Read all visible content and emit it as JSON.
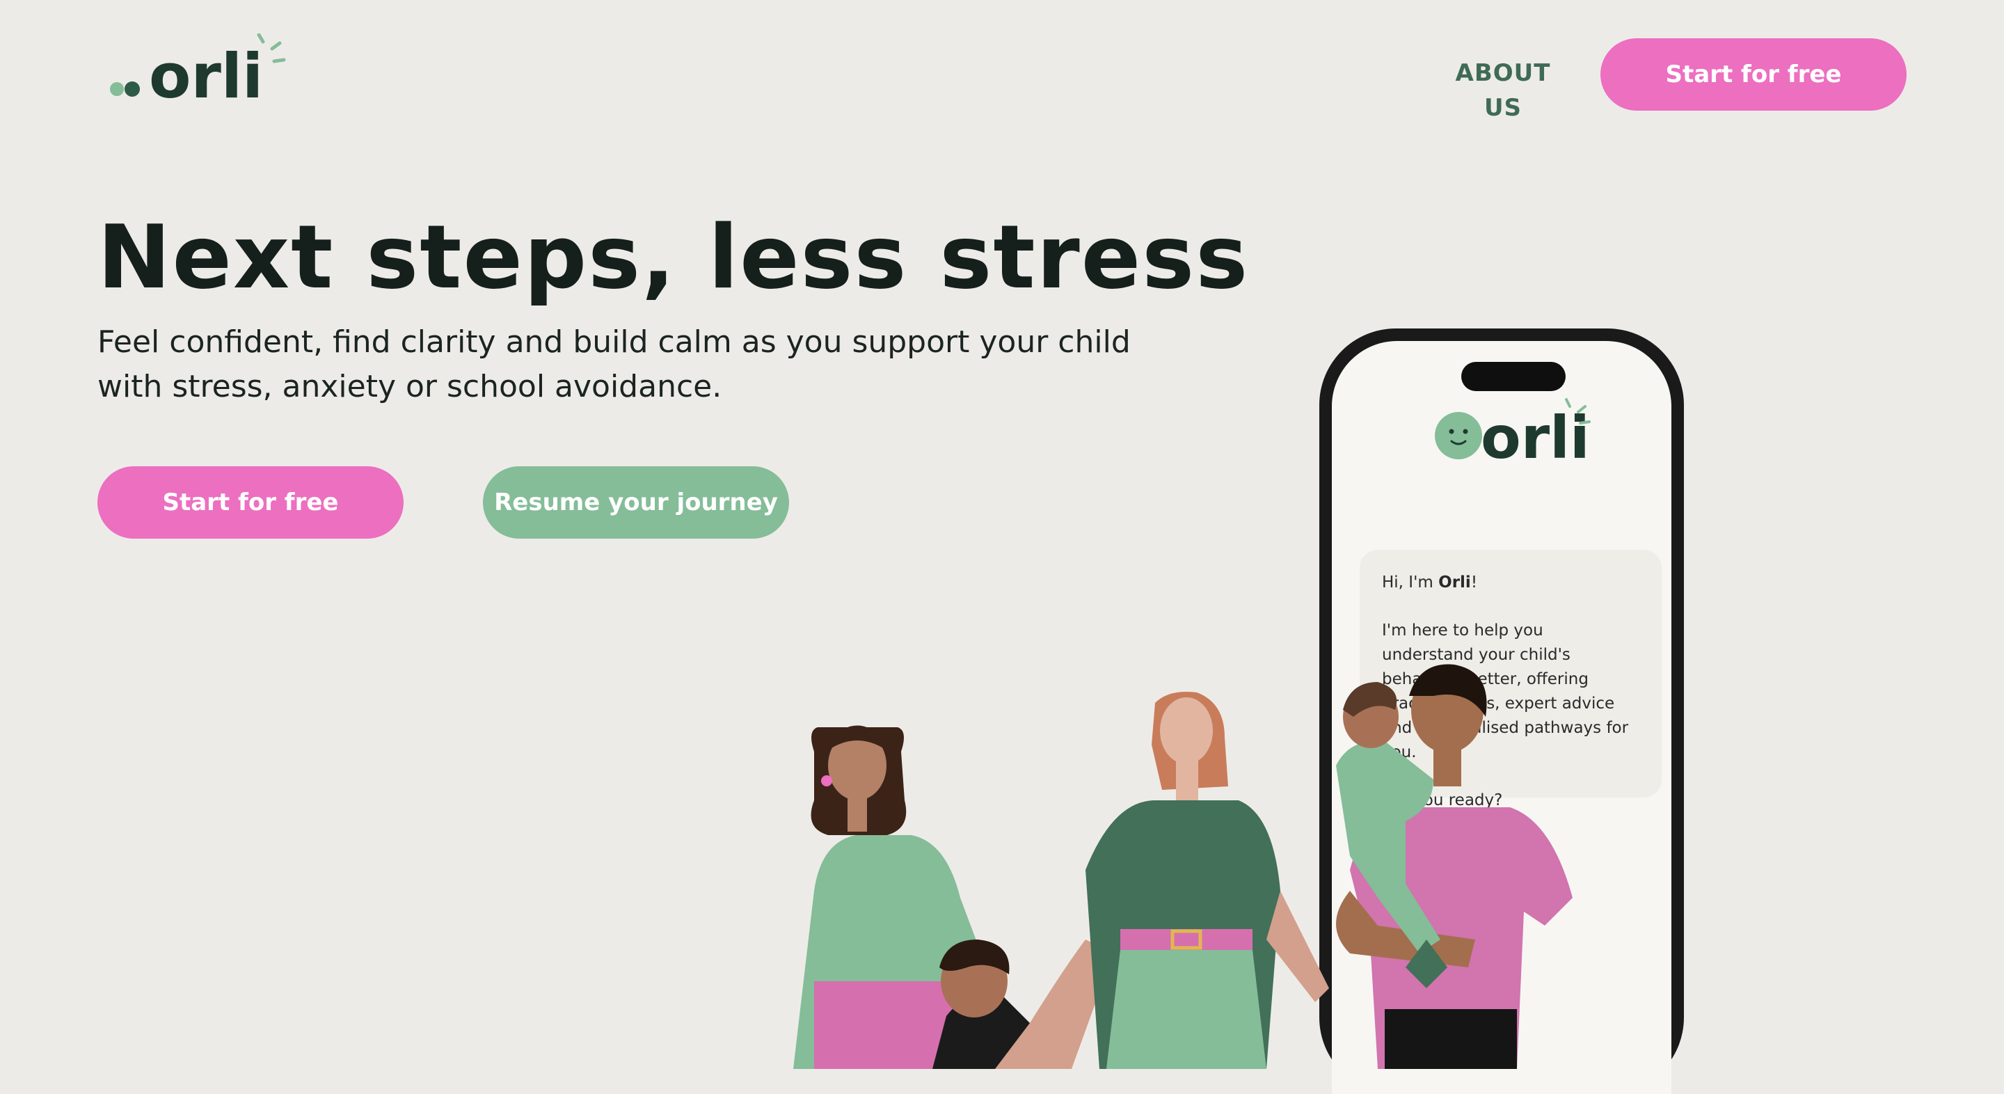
{
  "brand": {
    "name": "orli"
  },
  "nav": {
    "about": "ABOUT US",
    "cta": "Start for free"
  },
  "hero": {
    "title": "Next steps, less stress",
    "subtitle": "Feel confident, find clarity and build calm as you support your child with stress, anxiety or school avoidance.",
    "primary_cta": "Start for free",
    "secondary_cta": "Resume your journey"
  },
  "phone": {
    "logo": "orli",
    "greeting_prefix": "Hi, I'm ",
    "greeting_name": "Orli",
    "greeting_suffix": "!",
    "message": "I'm here to help you understand your child's behaviour better, offering practical tools, expert advice and personalised pathways for you.",
    "question": "Are you ready?"
  },
  "colors": {
    "background": "#edebe8",
    "brand_green": "#3f6b55",
    "accent_pink": "#ec6fc0",
    "accent_green": "#84bd98",
    "text_dark": "#15201c"
  }
}
